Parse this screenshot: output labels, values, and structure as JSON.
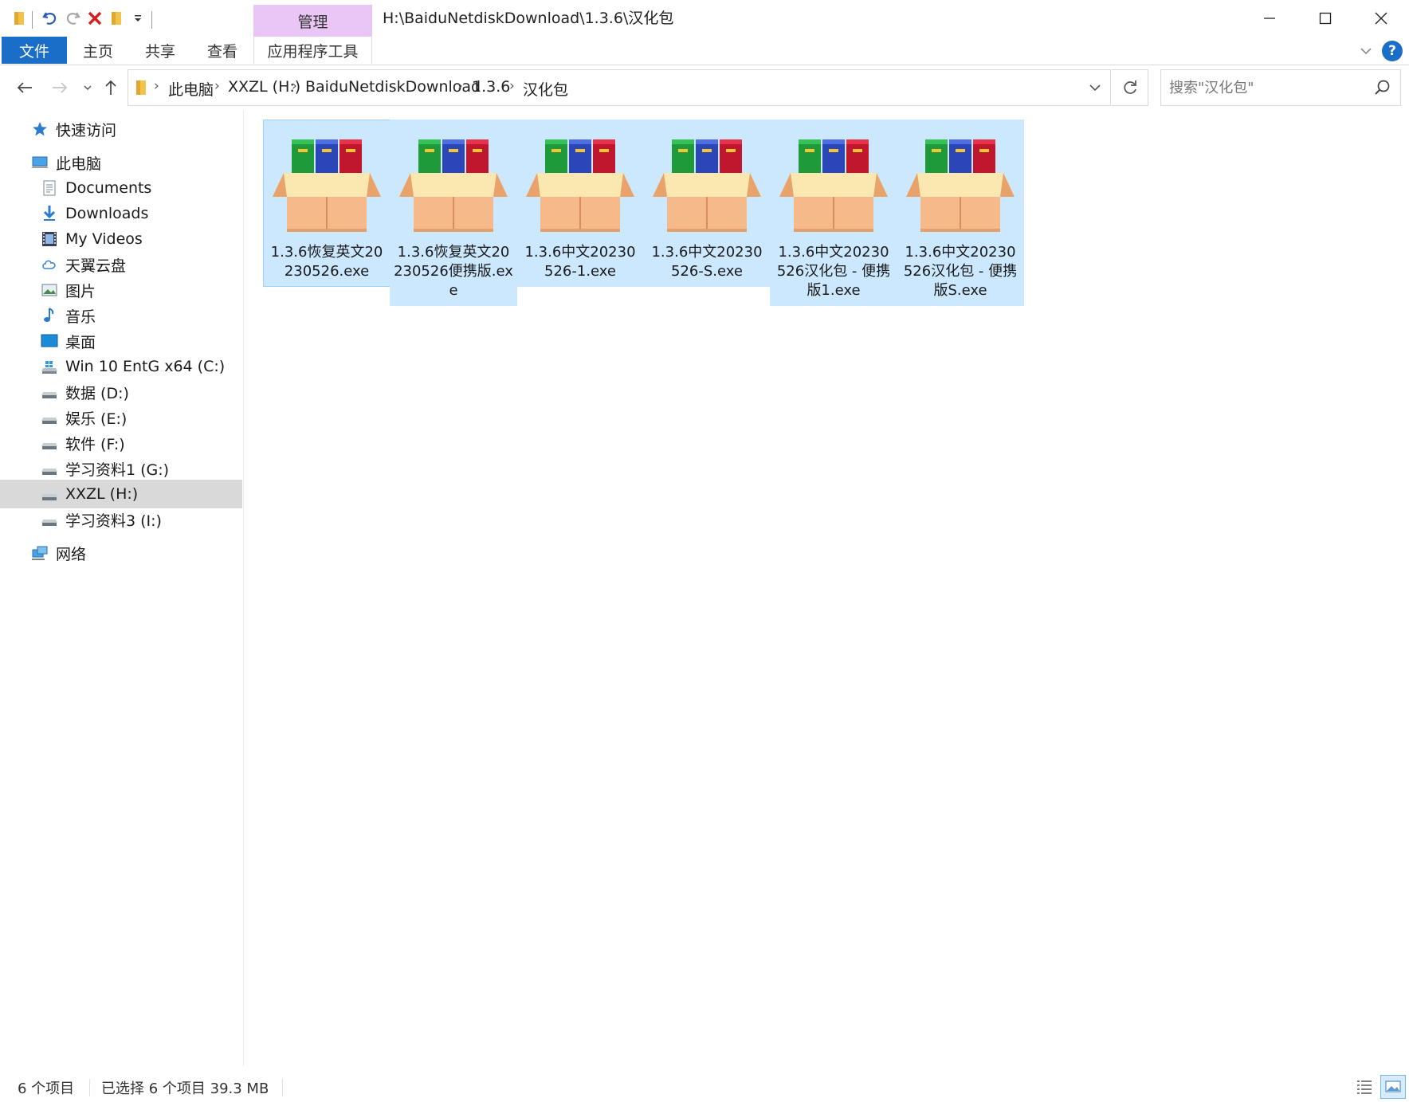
{
  "titlebar": {
    "manage_tab": "管理",
    "path": "H:\\BaiduNetdiskDownload\\1.3.6\\汉化包"
  },
  "ribbon": {
    "tabs": [
      "文件",
      "主页",
      "共享",
      "查看"
    ],
    "context_tab": "应用程序工具",
    "help_label": "?"
  },
  "address": {
    "crumbs": [
      "此电脑",
      "XXZL (H:)",
      "BaiduNetdiskDownload",
      "1.3.6",
      "汉化包"
    ]
  },
  "search": {
    "placeholder": "搜索\"汉化包\""
  },
  "sidebar": {
    "quick_access": "快速访问",
    "this_pc": "此电脑",
    "items": [
      {
        "label": "Documents",
        "icon": "documents-icon"
      },
      {
        "label": "Downloads",
        "icon": "downloads-icon"
      },
      {
        "label": "My Videos",
        "icon": "videos-icon"
      },
      {
        "label": "天翼云盘",
        "icon": "cloud-icon"
      },
      {
        "label": "图片",
        "icon": "pictures-icon"
      },
      {
        "label": "音乐",
        "icon": "music-icon"
      },
      {
        "label": "桌面",
        "icon": "desktop-icon"
      },
      {
        "label": "Win 10 EntG x64 (C:)",
        "icon": "windows-drive-icon"
      },
      {
        "label": "数据 (D:)",
        "icon": "drive-icon"
      },
      {
        "label": "娱乐 (E:)",
        "icon": "drive-icon"
      },
      {
        "label": "软件 (F:)",
        "icon": "drive-icon"
      },
      {
        "label": "学习资料1 (G:)",
        "icon": "drive-icon"
      },
      {
        "label": "XXZL (H:)",
        "icon": "drive-icon",
        "selected": true
      },
      {
        "label": "学习资料3 (I:)",
        "icon": "drive-icon"
      }
    ],
    "network": "网络"
  },
  "files": [
    {
      "name": "1.3.6恢复英文20230526.exe",
      "icon": "installer-package-icon"
    },
    {
      "name": "1.3.6恢复英文20230526便携版.exe",
      "icon": "installer-package-icon"
    },
    {
      "name": "1.3.6中文20230526-1.exe",
      "icon": "installer-package-icon"
    },
    {
      "name": "1.3.6中文20230526-S.exe",
      "icon": "installer-package-icon"
    },
    {
      "name": "1.3.6中文20230526汉化包 - 便携版1.exe",
      "icon": "installer-package-icon"
    },
    {
      "name": "1.3.6中文20230526汉化包 - 便携版S.exe",
      "icon": "installer-package-icon"
    }
  ],
  "status": {
    "count": "6 个项目",
    "selection": "已选择 6 个项目  39.3 MB"
  },
  "colors": {
    "file_tab": "#1a6ec7",
    "manage_tab": "#e9c6f5",
    "selection": "#cce8ff",
    "sidebar_selected": "#d9d9d9"
  }
}
